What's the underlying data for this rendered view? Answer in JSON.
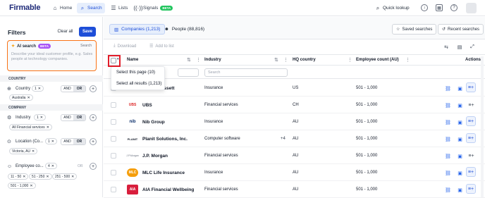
{
  "nav": {
    "logo": "Firmable",
    "home": "Home",
    "search": "Search",
    "lists": "Lists",
    "signals": "Signals",
    "signals_badge": "BETA",
    "quick_lookup": "Quick lookup"
  },
  "filters": {
    "title": "Filters",
    "clear_all": "Clear all",
    "save": "Save",
    "ai_search_label": "AI search",
    "ai_badge": "BETA",
    "ai_search_action": "Search",
    "ai_placeholder": "Describe your ideal customer profile, e.g. Sales people at technology companies.",
    "section_country": "COUNTRY",
    "section_company": "COMPANY",
    "country": {
      "label": "Country",
      "count": "1",
      "chips": [
        "Australia"
      ]
    },
    "industry": {
      "label": "Industry",
      "count": "1",
      "chips": [
        "All Financial services"
      ]
    },
    "location": {
      "label": "Location (Co...",
      "count": "1",
      "chips": [
        "Victoria, AU"
      ]
    },
    "employee": {
      "label": "Employee co...",
      "count": "4",
      "chips": [
        "11 - 50",
        "51 - 250",
        "251 - 500",
        "501 - 1,000"
      ]
    },
    "and_label": "AND",
    "or_label": "OR"
  },
  "tabs": {
    "companies": "Companies (1,213)",
    "people": "People (88,816)",
    "saved_searches": "Saved searches",
    "recent_searches": "Recent searches"
  },
  "toolbar": {
    "download": "Download",
    "add_to_list": "Add to list"
  },
  "table": {
    "headers": {
      "name": "Name",
      "industry": "Industry",
      "hq": "HQ country",
      "employees": "Employee count (AU)",
      "actions": "Actions"
    },
    "search_placeholder": "Search",
    "rows": [
      {
        "logo": "",
        "name": "...ssett",
        "industry": "Insurance",
        "hq": "US",
        "employees": "501 - 1,000",
        "extra": ""
      },
      {
        "logo": "UBS",
        "name": "UBS",
        "industry": "Financial services",
        "hq": "CH",
        "employees": "501 - 1,000",
        "extra": ""
      },
      {
        "logo": "nib",
        "name": "Nib Group",
        "industry": "Insurance",
        "hq": "AU",
        "employees": "501 - 1,000",
        "extra": ""
      },
      {
        "logo": "PLANIT",
        "name": "Planit Solutions, Inc.",
        "industry": "Computer software",
        "hq": "AU",
        "employees": "501 - 1,000",
        "extra": "+4"
      },
      {
        "logo": "J.P.Morgan",
        "name": "J.P. Morgan",
        "industry": "Financial services",
        "hq": "AU",
        "employees": "501 - 1,000",
        "extra": ""
      },
      {
        "logo": "MLC",
        "name": "MLC Life Insurance",
        "industry": "Insurance",
        "hq": "AU",
        "employees": "501 - 1,000",
        "extra": ""
      },
      {
        "logo": "AIA",
        "name": "AIA Financial Wellbeing",
        "industry": "Financial services",
        "hq": "AU",
        "employees": "501 - 1,000",
        "extra": ""
      }
    ]
  },
  "dropdown": {
    "select_page": "Select this page (10)",
    "select_all": "Select all results (1,213)"
  }
}
